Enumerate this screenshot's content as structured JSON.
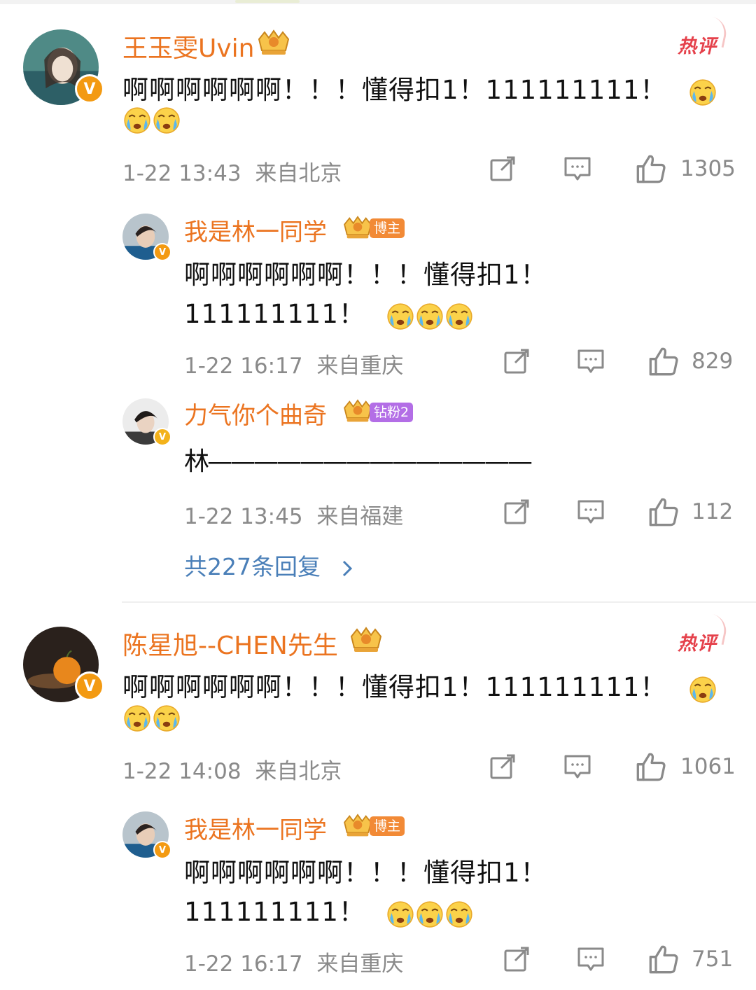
{
  "hot_label": "热评",
  "comments": [
    {
      "user": "王玉雯Uvin",
      "crown_level": "8",
      "text_line1": "啊啊啊啊啊啊！！！懂得扣1！111111111！",
      "time": "1-22 13:43",
      "location": "来自北京",
      "likes": "1305",
      "replies": [
        {
          "user": "我是林一同学",
          "crown_level": "9",
          "tag": "博主",
          "text_line1": "啊啊啊啊啊啊！！！懂得扣1！",
          "text_line2": "111111111！",
          "time": "1-22 16:17",
          "location": "来自重庆",
          "likes": "829"
        },
        {
          "user": "力气你个曲奇",
          "crown_level": "9",
          "tag": "钻粉2",
          "text_line1": "林——————————————",
          "time": "1-22 13:45",
          "location": "来自福建",
          "likes": "112"
        }
      ],
      "reply_total": "共227条回复"
    },
    {
      "user": "陈星旭--CHEN先生",
      "crown_level": "8",
      "text_line1": "啊啊啊啊啊啊！！！懂得扣1！111111111！",
      "time": "1-22 14:08",
      "location": "来自北京",
      "likes": "1061",
      "replies": [
        {
          "user": "我是林一同学",
          "crown_level": "9",
          "tag": "博主",
          "text_line1": "啊啊啊啊啊啊！！！懂得扣1！",
          "text_line2": "111111111！",
          "time": "1-22 16:17",
          "location": "来自重庆",
          "likes": "751"
        }
      ]
    }
  ],
  "icons": {
    "share": "share-icon",
    "comment": "comment-icon",
    "like": "thumbs-up-icon",
    "emoji": "crying-emoji-icon",
    "crown": "crown-badge-icon",
    "verified": "verified-v-icon",
    "chevron": "chevron-right-icon"
  },
  "colors": {
    "username": "#eb7420",
    "hot": "#e5414b",
    "link": "#4a7fb8",
    "meta": "#8a8a8a",
    "verified": "#f39a12"
  }
}
